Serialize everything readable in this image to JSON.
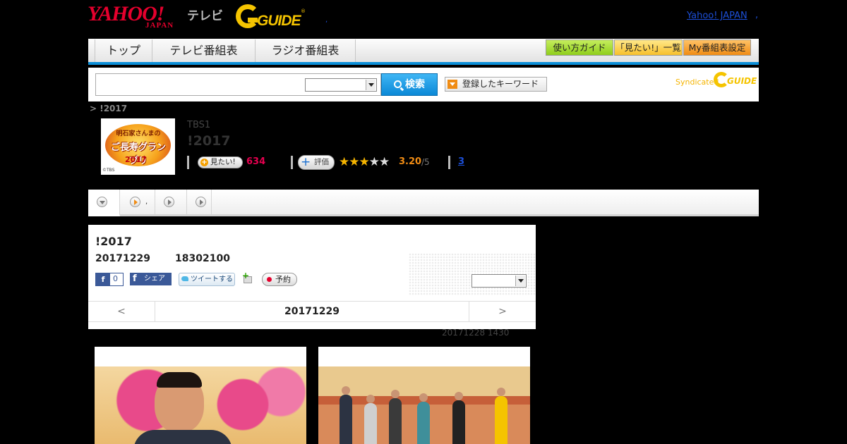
{
  "header": {
    "yahoo_logo": "YAHOO!",
    "japan_logo": "JAPAN",
    "tv_label": "テレビ",
    "gguide_logo": "GUIDE",
    "gguide_reg": "®",
    "link_yahoo_japan": "Yahoo! JAPAN",
    "link_dot": ",",
    "tiny_dot": ","
  },
  "nav": {
    "tabs": [
      "トップ",
      "テレビ番組表",
      "ラジオ番組表"
    ],
    "buttons": [
      "使い方ガイド",
      "「見たい!」一覧",
      "My番組表設定"
    ]
  },
  "search": {
    "input_value": "",
    "select_value": "",
    "button_label": "検索",
    "keyword_button": "登録したキーワード",
    "syndicated": "Syndicated",
    "syn_logo": "GUIDE"
  },
  "breadcrumb": "> !2017",
  "program": {
    "thumb_line1": "明石家さんまの",
    "thumb_line2": "ご長寿グランプリ",
    "thumb_year": "2017",
    "thumb_copyright": "©TBS",
    "channel": "TBS1",
    "title": "!2017",
    "mitai_label": "見たい!",
    "mitai_plus": "+",
    "mitai_count": "634",
    "rate_label": "評価",
    "rate_plus": "+",
    "stars_on": "★★★",
    "stars_off": "★★",
    "score": "3.20",
    "score_of": "/5",
    "review_count": "3"
  },
  "subtabs": {
    "dot": ","
  },
  "detail": {
    "title": "!2017",
    "date": "20171229",
    "time": "18302100",
    "fb_like_f": "f",
    "fb_like_count": "0",
    "fb_share_f": "f",
    "fb_share_label": "シェア",
    "tweet_label": "ツイートする",
    "plus_icon": "+",
    "reserve_label": "予約",
    "select_value": "",
    "prev": "<",
    "current_date": "20171229",
    "next": ">"
  },
  "update_note": "20171228  1430"
}
